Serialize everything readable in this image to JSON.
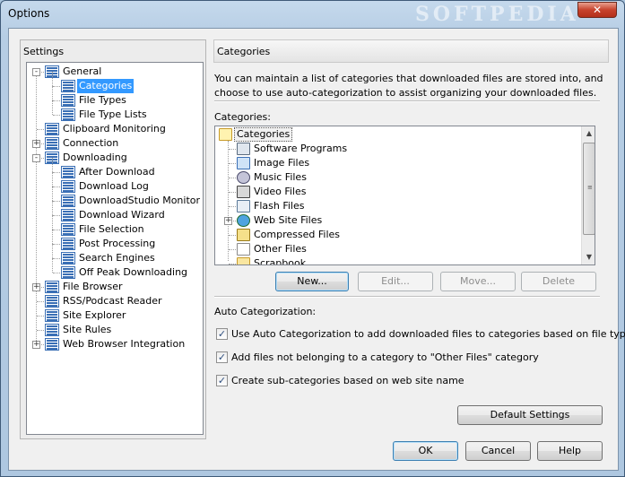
{
  "window": {
    "title": "Options",
    "watermark": "SOFTPEDIA"
  },
  "settings": {
    "header": "Settings",
    "tree": [
      {
        "label": "General",
        "level": 0,
        "expander": "-",
        "selected": false
      },
      {
        "label": "Categories",
        "level": 1,
        "expander": "",
        "selected": true
      },
      {
        "label": "File Types",
        "level": 1,
        "expander": "",
        "selected": false
      },
      {
        "label": "File Type Lists",
        "level": 1,
        "expander": "",
        "selected": false
      },
      {
        "label": "Clipboard Monitoring",
        "level": 0,
        "expander": "",
        "selected": false
      },
      {
        "label": "Connection",
        "level": 0,
        "expander": "+",
        "selected": false
      },
      {
        "label": "Downloading",
        "level": 0,
        "expander": "-",
        "selected": false
      },
      {
        "label": "After Download",
        "level": 1,
        "expander": "",
        "selected": false
      },
      {
        "label": "Download Log",
        "level": 1,
        "expander": "",
        "selected": false
      },
      {
        "label": "DownloadStudio Monitor",
        "level": 1,
        "expander": "",
        "selected": false
      },
      {
        "label": "Download Wizard",
        "level": 1,
        "expander": "",
        "selected": false
      },
      {
        "label": "File Selection",
        "level": 1,
        "expander": "",
        "selected": false
      },
      {
        "label": "Post Processing",
        "level": 1,
        "expander": "",
        "selected": false
      },
      {
        "label": "Search Engines",
        "level": 1,
        "expander": "",
        "selected": false
      },
      {
        "label": "Off Peak Downloading",
        "level": 1,
        "expander": "",
        "selected": false
      },
      {
        "label": "File Browser",
        "level": 0,
        "expander": "+",
        "selected": false
      },
      {
        "label": "RSS/Podcast Reader",
        "level": 0,
        "expander": "",
        "selected": false
      },
      {
        "label": "Site Explorer",
        "level": 0,
        "expander": "",
        "selected": false
      },
      {
        "label": "Site Rules",
        "level": 0,
        "expander": "",
        "selected": false
      },
      {
        "label": "Web Browser Integration",
        "level": 0,
        "expander": "+",
        "selected": false
      }
    ]
  },
  "page": {
    "header": "Categories",
    "description": "You can maintain a list of categories that downloaded files are stored into, and choose to use auto-categorization to assist organizing your downloaded files.",
    "categories_label": "Categories:",
    "categories": [
      {
        "label": "Categories",
        "icon": "folder-open-icon",
        "root": true,
        "expander": ""
      },
      {
        "label": "Software Programs",
        "icon": "software-icon",
        "root": false,
        "expander": ""
      },
      {
        "label": "Image Files",
        "icon": "image-icon",
        "root": false,
        "expander": ""
      },
      {
        "label": "Music Files",
        "icon": "music-icon",
        "root": false,
        "expander": ""
      },
      {
        "label": "Video Files",
        "icon": "video-icon",
        "root": false,
        "expander": ""
      },
      {
        "label": "Flash Files",
        "icon": "flash-icon",
        "root": false,
        "expander": ""
      },
      {
        "label": "Web Site Files",
        "icon": "globe-icon",
        "root": false,
        "expander": "+"
      },
      {
        "label": "Compressed Files",
        "icon": "archive-icon",
        "root": false,
        "expander": ""
      },
      {
        "label": "Other Files",
        "icon": "file-icon",
        "root": false,
        "expander": ""
      },
      {
        "label": "Scrapbook",
        "icon": "folder-icon",
        "root": false,
        "expander": ""
      }
    ],
    "buttons": {
      "new": "New...",
      "edit": "Edit...",
      "move": "Move...",
      "delete": "Delete"
    },
    "auto_label": "Auto Categorization:",
    "checkboxes": [
      {
        "label": "Use Auto Categorization to add downloaded files to categories based on file type",
        "checked": true
      },
      {
        "label": "Add files not belonging to a category to \"Other Files\" category",
        "checked": true
      },
      {
        "label": "Create sub-categories based on web site name",
        "checked": true
      }
    ],
    "default_button": "Default Settings"
  },
  "footer": {
    "ok": "OK",
    "cancel": "Cancel",
    "help": "Help"
  },
  "close_glyph": "✕"
}
